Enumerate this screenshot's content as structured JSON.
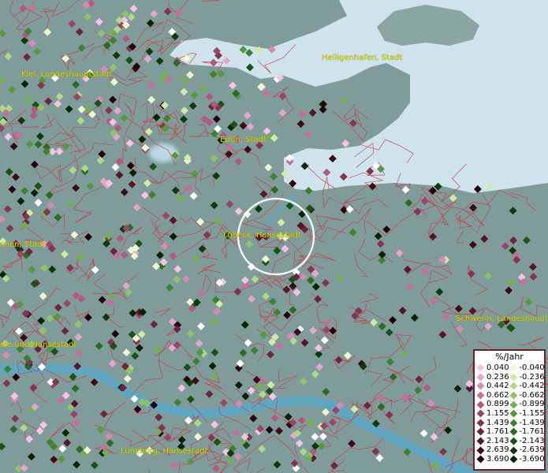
{
  "map": {
    "cities": [
      {
        "id": "kiel",
        "name": "Kiel, Landeshauptstadt"
      },
      {
        "id": "heiligenhafen",
        "name": "Heiligenhafen, Stadt"
      },
      {
        "id": "eutin",
        "name": "Eutin, Stadt"
      },
      {
        "id": "luebeck",
        "name": "Lübeck, Hansestadt"
      },
      {
        "id": "neumuenster",
        "name": "chen, Stadt"
      },
      {
        "id": "schwerin",
        "name": "Schwerin, Landeshaupt"
      },
      {
        "id": "hamburg",
        "name": "eie und Hansestadt"
      },
      {
        "id": "lueneburg",
        "name": "Lüneburg, Hansestadt"
      }
    ],
    "colors": {
      "water": "#cfe3ec",
      "land": "#7f9c9a",
      "boundary": "#c83a46",
      "river": "#5aa8c8",
      "selection": "#ffffff"
    }
  },
  "legend": {
    "title": "%/Jahr",
    "positive": [
      {
        "label": "0.040",
        "color": "#f6c2e6"
      },
      {
        "label": "0.236",
        "color": "#e4a6cc"
      },
      {
        "label": "0.442",
        "color": "#d68ab4"
      },
      {
        "label": "0.662",
        "color": "#c4709a"
      },
      {
        "label": "0.899",
        "color": "#b05a82"
      },
      {
        "label": "1.155",
        "color": "#9a4468"
      },
      {
        "label": "1.439",
        "color": "#843450"
      },
      {
        "label": "1.761",
        "color": "#6e243a"
      },
      {
        "label": "2.143",
        "color": "#561626"
      },
      {
        "label": "2.639",
        "color": "#3e0a16"
      },
      {
        "label": "3.690",
        "color": "#260008"
      }
    ],
    "negative": [
      {
        "label": "-0.040",
        "color": "#f0f8d0"
      },
      {
        "label": "-0.236",
        "color": "#d2eaa8"
      },
      {
        "label": "-0.442",
        "color": "#b0d88a"
      },
      {
        "label": "-0.662",
        "color": "#90c46c"
      },
      {
        "label": "-0.899",
        "color": "#72ae54"
      },
      {
        "label": "-1.155",
        "color": "#569840"
      },
      {
        "label": "-1.439",
        "color": "#3e8230"
      },
      {
        "label": "-1.761",
        "color": "#2a6a22"
      },
      {
        "label": "-2.143",
        "color": "#185216"
      },
      {
        "label": "-2.639",
        "color": "#0c3a0c"
      },
      {
        "label": "-3.690",
        "color": "#042404"
      }
    ]
  }
}
